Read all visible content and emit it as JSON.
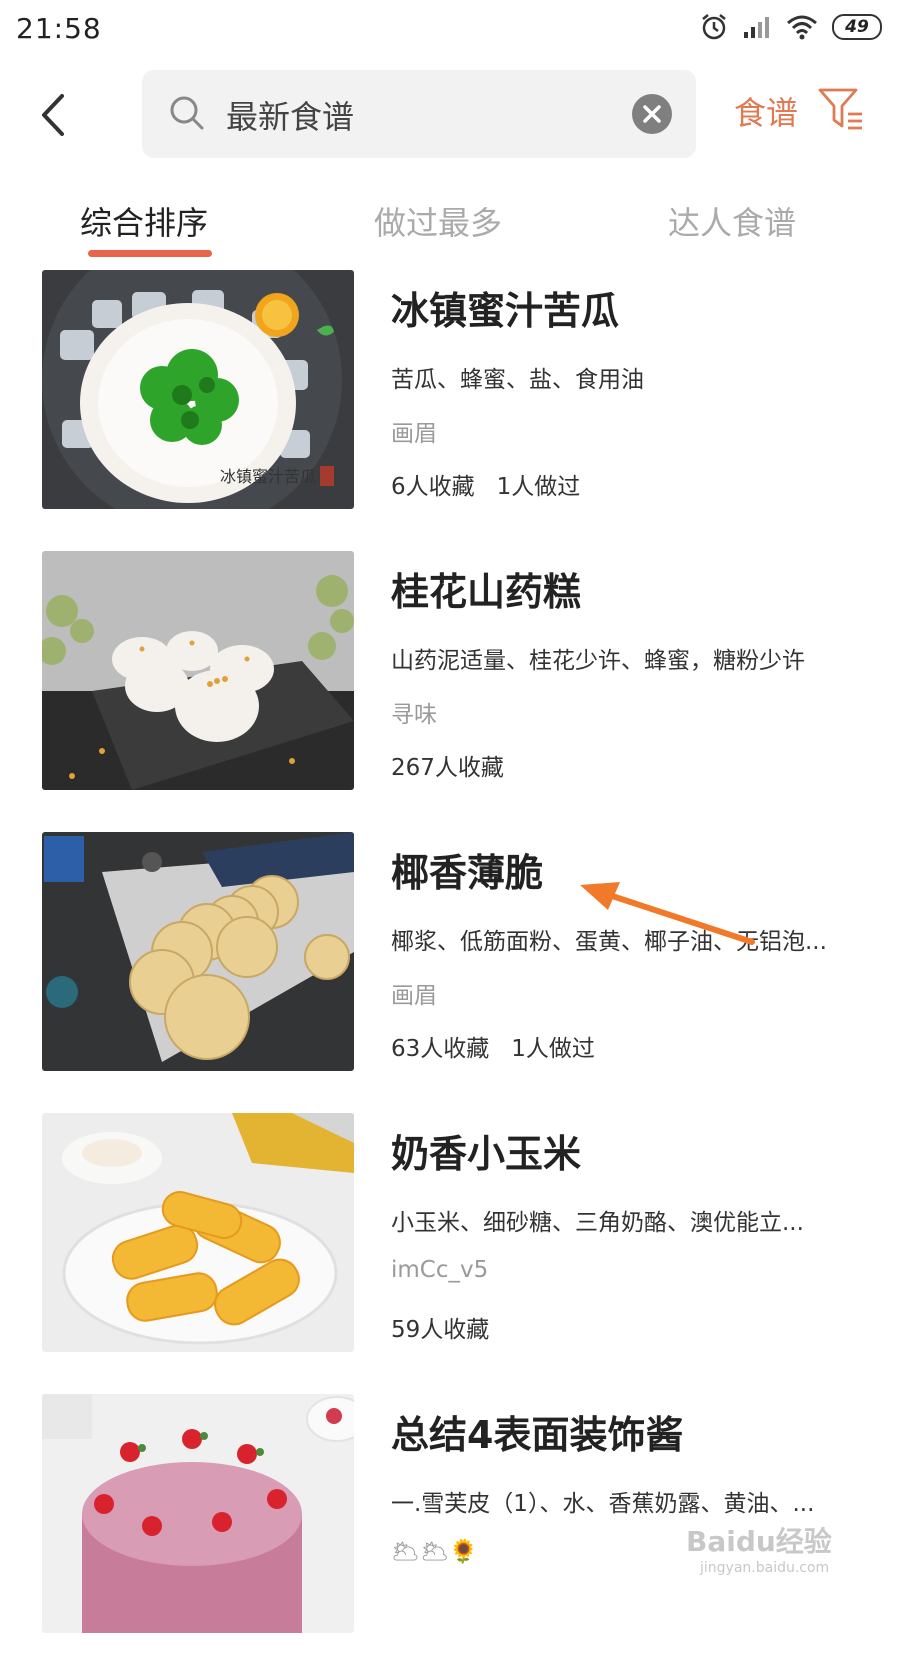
{
  "status": {
    "time": "21:58",
    "battery": "49"
  },
  "search": {
    "value": "最新食谱",
    "filter_label": "食谱"
  },
  "tabs": [
    {
      "label": "综合排序",
      "active": true
    },
    {
      "label": "做过最多",
      "active": false
    },
    {
      "label": "达人食谱",
      "active": false
    }
  ],
  "recipes": [
    {
      "title": "冰镇蜜汁苦瓜",
      "image_caption": "冰镇蜜汁苦瓜",
      "ingredients": "苦瓜、蜂蜜、盐、食用油",
      "author": "画眉",
      "favorites": "6人收藏",
      "made": "1人做过"
    },
    {
      "title": "桂花山药糕",
      "ingredients": "山药泥适量、桂花少许、蜂蜜，糖粉少许",
      "author": "寻味",
      "favorites": "267人收藏",
      "made": ""
    },
    {
      "title": "椰香薄脆",
      "ingredients": "椰浆、低筋面粉、蛋黄、椰子油、无铝泡...",
      "author": "画眉",
      "favorites": "63人收藏",
      "made": "1人做过"
    },
    {
      "title": "奶香小玉米",
      "ingredients": "小玉米、细砂糖、三角奶酪、澳优能立...",
      "author": "imCc_v5",
      "favorites": "59人收藏",
      "made": ""
    },
    {
      "title": "总结4表面装饰酱",
      "ingredients": "一.雪芙皮（1）、水、香蕉奶露、黄油、...",
      "author": "🌥🌥🌻",
      "favorites": "",
      "made": ""
    }
  ],
  "watermark": {
    "brand": "Baidu经验",
    "url": "jingyan.baidu.com"
  },
  "colors": {
    "accent": "#e8644a",
    "filter": "#e07a52",
    "annotation_arrow": "#f07a2a"
  }
}
